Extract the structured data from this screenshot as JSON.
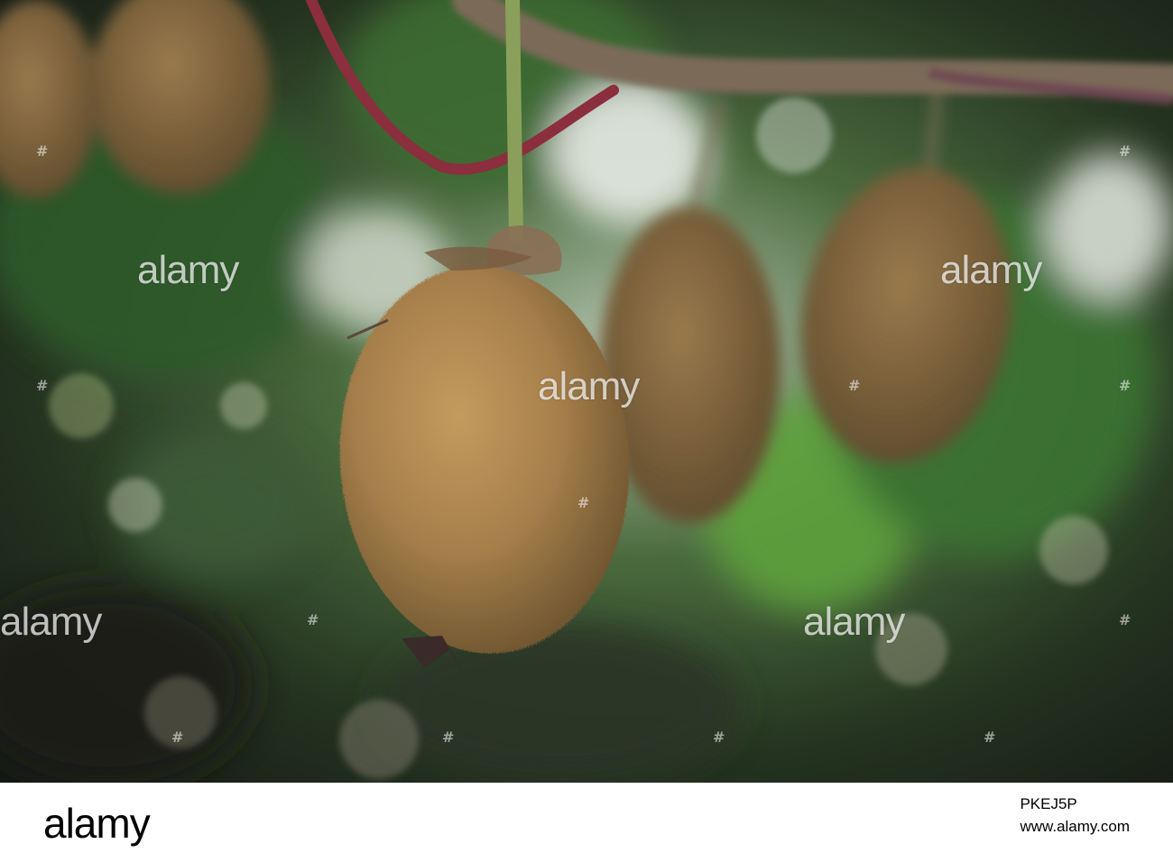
{
  "photo": {
    "subject": "kiwi fruit",
    "palette": {
      "background": "#1f2a1c",
      "foliage": "#3d7a2e",
      "fruit": "#a6804a",
      "vine": "#7c5f4c",
      "stem": "#8b3040"
    }
  },
  "watermark": {
    "text": "alamy"
  },
  "footer": {
    "logo_text": "alamy",
    "image_id": "PKEJ5P",
    "site": "www.alamy.com"
  }
}
